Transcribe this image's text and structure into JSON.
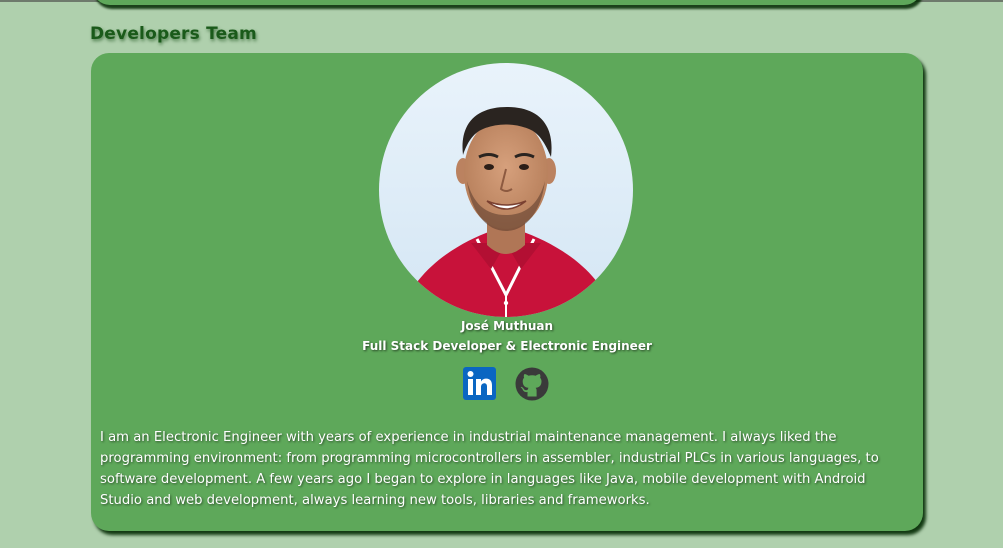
{
  "section": {
    "title": "Developers Team"
  },
  "developer": {
    "name": "José Muthuan",
    "role": "Full Stack Developer & Electronic Engineer",
    "photo_icon": "profile-photo",
    "bio": "I am an Electronic Engineer with years of experience in industrial maintenance management. I always liked the programming environment: from programming microcontrollers in assembler, industrial PLCs in various languages, to software development. A few years ago I began to explore in languages like Java, mobile development with Android Studio and web development, always learning new tools, libraries and frameworks.",
    "links": [
      {
        "name": "LinkedIn",
        "icon": "linkedin-icon",
        "color": "#0a66c2"
      },
      {
        "name": "GitHub",
        "icon": "github-icon",
        "color": "#3a3a3a"
      }
    ]
  },
  "colors": {
    "page_background": "#afd0ad",
    "card_background": "#5ea85a",
    "title_color": "#1a5a1a",
    "text_color": "#ffffff"
  }
}
